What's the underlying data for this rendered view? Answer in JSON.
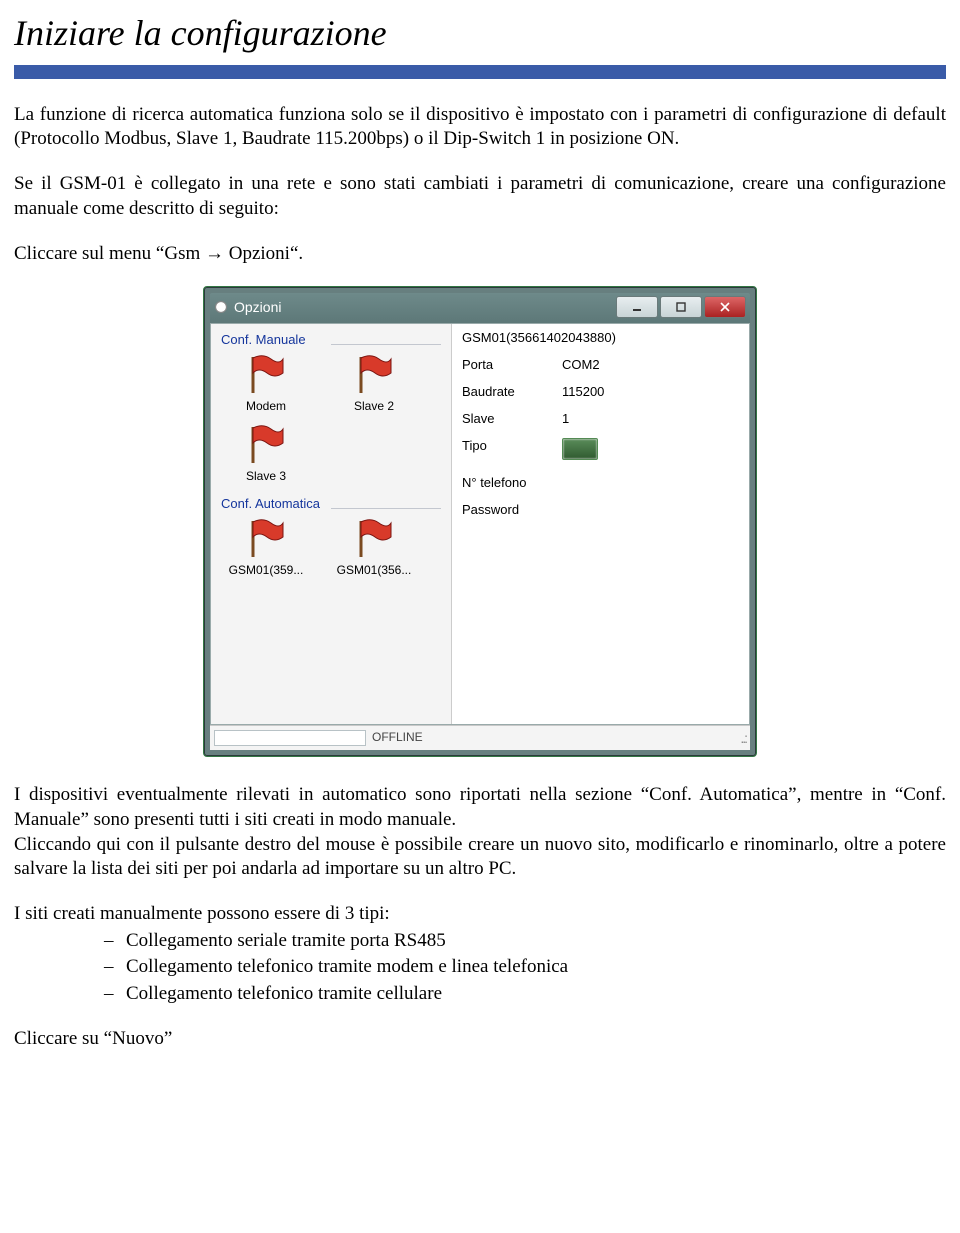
{
  "doc": {
    "title": "Iniziare la configurazione",
    "p1": "La funzione di ricerca automatica funziona solo se il dispositivo è impostato con i parametri di configurazione di default (Protocollo Modbus, Slave 1, Baudrate 115.200bps) o il Dip-Switch 1 in posizione ON.",
    "p2": "Se il GSM-01 è collegato in una rete e sono stati cambiati i parametri di comunicazione, creare una configurazione manuale come descritto di seguito:",
    "p3": "Cliccare sul menu “Gsm → Opzioni“.",
    "p4": "I dispositivi eventualmente rilevati in automatico sono riportati nella sezione “Conf. Automatica”, mentre in “Conf. Manuale” sono presenti tutti i siti creati in modo manuale.",
    "p5": "Cliccando qui con il pulsante destro del mouse è possibile creare un nuovo sito, modificarlo e rinominarlo, oltre a potere salvare la lista dei siti per poi andarla ad importare su un altro PC.",
    "p6": "I siti creati manualmente possono essere di 3 tipi:",
    "li1": "Collegamento seriale tramite porta RS485",
    "li2": "Collegamento telefonico tramite modem e linea telefonica",
    "li3": "Collegamento telefonico tramite cellulare",
    "p7": "Cliccare su “Nuovo”"
  },
  "dialog": {
    "title": "Opzioni",
    "group_manual": "Conf. Manuale",
    "group_auto": "Conf. Automatica",
    "sites_manual": {
      "s1": "Modem",
      "s2": "Slave 2",
      "s3": "Slave 3"
    },
    "sites_auto": {
      "a1": "GSM01(359...",
      "a2": "GSM01(356..."
    },
    "props": {
      "header": "GSM01(35661402043880)",
      "porta_k": "Porta",
      "porta_v": "COM2",
      "baud_k": "Baudrate",
      "baud_v": "115200",
      "slave_k": "Slave",
      "slave_v": "1",
      "tipo_k": "Tipo",
      "tel_k": "N° telefono",
      "pwd_k": "Password"
    },
    "status": "OFFLINE"
  }
}
